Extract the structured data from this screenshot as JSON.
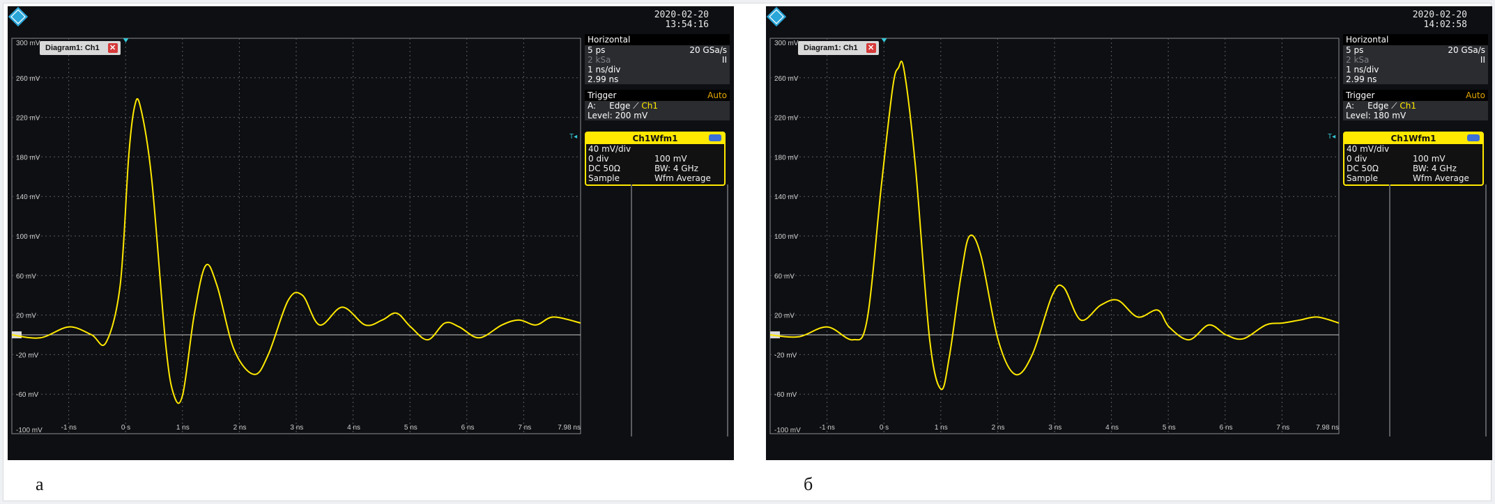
{
  "captions": [
    "а",
    "б"
  ],
  "colors": {
    "trace": "#ffe900",
    "grid": "#5b5d63",
    "background": "#0e0f12",
    "accent": "#ffe900",
    "logo": "#2aa6d9"
  },
  "scopes": [
    {
      "date": "2020-02-20",
      "time": "13:54:16",
      "diagram_tab": "Diagram1: Ch1",
      "close_glyph": "✕",
      "horizontal": {
        "title": "Horizontal",
        "res": "5 ps",
        "rate": "20 GSa/s",
        "rec": "2 kSa",
        "mode": "II",
        "scale": "1 ns/div",
        "pos": "2.99 ns"
      },
      "trigger": {
        "title": "Trigger",
        "mode": "Auto",
        "src_label": "A:",
        "type": "Edge",
        "channel": "Ch1",
        "level": "Level: 200 mV"
      },
      "channel_box": {
        "title": "Ch1Wfm1",
        "scale": "40 mV/div",
        "offset": "0 div",
        "offset_val": "100 mV",
        "coupling": "DC 50Ω",
        "bw": "BW: 4 GHz",
        "acq": "Sample",
        "wfm": "Wfm Average"
      }
    },
    {
      "date": "2020-02-20",
      "time": "14:02:58",
      "diagram_tab": "Diagram1: Ch1",
      "close_glyph": "✕",
      "horizontal": {
        "title": "Horizontal",
        "res": "5 ps",
        "rate": "20 GSa/s",
        "rec": "2 kSa",
        "mode": "II",
        "scale": "1 ns/div",
        "pos": "2.99 ns"
      },
      "trigger": {
        "title": "Trigger",
        "mode": "Auto",
        "src_label": "A:",
        "type": "Edge",
        "channel": "Ch1",
        "level": "Level: 180 mV"
      },
      "channel_box": {
        "title": "Ch1Wfm1",
        "scale": "40 mV/div",
        "offset": "0 div",
        "offset_val": "100 mV",
        "coupling": "DC 50Ω",
        "bw": "BW: 4 GHz",
        "acq": "Sample",
        "wfm": "Wfm Average"
      }
    }
  ],
  "chart_data": [
    {
      "type": "line",
      "xlabel": "",
      "ylabel": "",
      "xlim": [
        -2.0,
        7.98
      ],
      "ylim": [
        -100,
        300
      ],
      "x_ticks": [
        "-1 ns",
        "0 s",
        "1 ns",
        "2 ns",
        "3 ns",
        "4 ns",
        "5 ns",
        "6 ns",
        "7 ns",
        "7.98 ns"
      ],
      "x_tick_values": [
        -1,
        0,
        1,
        2,
        3,
        4,
        5,
        6,
        7,
        7.98
      ],
      "y_ticks": [
        "300 mV",
        "260 mV",
        "220 mV",
        "180 mV",
        "140 mV",
        "100 mV",
        "60 mV",
        "20 mV",
        "-20 mV",
        "-60 mV",
        "-100 mV"
      ],
      "y_tick_values": [
        300,
        260,
        220,
        180,
        140,
        100,
        60,
        20,
        -20,
        -60,
        -100
      ],
      "grid": true,
      "series": [
        {
          "x": [
            -2.0,
            -1.5,
            -1.0,
            -0.6,
            -0.35,
            -0.1,
            0.05,
            0.15,
            0.25,
            0.45,
            0.7,
            0.85,
            1.0,
            1.2,
            1.4,
            1.6,
            1.9,
            2.25,
            2.5,
            2.85,
            3.1,
            3.4,
            3.8,
            4.2,
            4.5,
            4.75,
            5.0,
            5.3,
            5.6,
            5.85,
            6.2,
            6.6,
            6.9,
            7.2,
            7.5,
            7.98
          ],
          "y": [
            0,
            -3,
            8,
            0,
            -8,
            50,
            180,
            230,
            232,
            160,
            -10,
            -62,
            -60,
            20,
            70,
            50,
            -15,
            -40,
            -20,
            35,
            40,
            10,
            28,
            10,
            15,
            22,
            8,
            -5,
            12,
            8,
            -3,
            10,
            15,
            10,
            18,
            12
          ]
        }
      ]
    },
    {
      "type": "line",
      "xlabel": "",
      "ylabel": "",
      "xlim": [
        -2.0,
        7.98
      ],
      "ylim": [
        -100,
        300
      ],
      "x_ticks": [
        "-1 ns",
        "0 s",
        "1 ns",
        "2 ns",
        "3 ns",
        "4 ns",
        "5 ns",
        "6 ns",
        "7 ns",
        "7.98 ns"
      ],
      "x_tick_values": [
        -1,
        0,
        1,
        2,
        3,
        4,
        5,
        6,
        7,
        7.98
      ],
      "y_ticks": [
        "300 mV",
        "260 mV",
        "220 mV",
        "180 mV",
        "140 mV",
        "100 mV",
        "60 mV",
        "20 mV",
        "-20 mV",
        "-60 mV",
        "-100 mV"
      ],
      "y_tick_values": [
        300,
        260,
        220,
        180,
        140,
        100,
        60,
        20,
        -20,
        -60,
        -100
      ],
      "grid": true,
      "series": [
        {
          "x": [
            -2.0,
            -1.5,
            -1.0,
            -0.55,
            -0.3,
            -0.05,
            0.15,
            0.25,
            0.35,
            0.55,
            0.8,
            1.0,
            1.15,
            1.35,
            1.5,
            1.7,
            2.0,
            2.3,
            2.6,
            2.95,
            3.15,
            3.45,
            3.8,
            4.1,
            4.45,
            4.8,
            5.0,
            5.35,
            5.7,
            6.0,
            6.3,
            6.7,
            7.0,
            7.3,
            7.6,
            7.98
          ],
          "y": [
            0,
            -2,
            8,
            -5,
            15,
            150,
            250,
            270,
            268,
            170,
            -5,
            -55,
            -20,
            60,
            100,
            80,
            -5,
            -40,
            -20,
            40,
            48,
            15,
            30,
            35,
            18,
            25,
            8,
            -5,
            10,
            0,
            -4,
            10,
            12,
            15,
            18,
            12
          ]
        }
      ]
    }
  ]
}
